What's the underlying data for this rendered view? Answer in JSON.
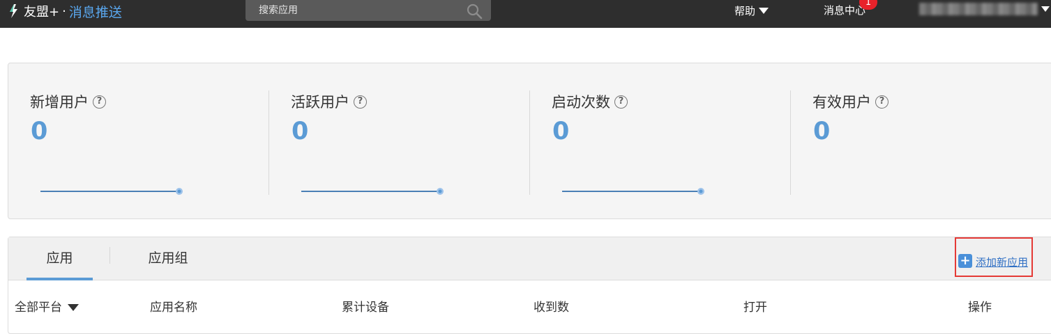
{
  "header": {
    "brand": "友盟+",
    "separator": "·",
    "product": "消息推送",
    "logo_icon": "umeng-logo-icon",
    "search": {
      "placeholder": "搜索应用",
      "icon": "search-icon"
    },
    "help": "帮助",
    "message_center": "消息中心",
    "message_badge": "1"
  },
  "stats": [
    {
      "label": "新增用户",
      "value": "0"
    },
    {
      "label": "活跃用户",
      "value": "0"
    },
    {
      "label": "启动次数",
      "value": "0"
    },
    {
      "label": "有效用户",
      "value": "0"
    }
  ],
  "apps": {
    "tabs": [
      {
        "label": "应用",
        "active": true
      },
      {
        "label": "应用组",
        "active": false
      }
    ],
    "add_app": "添加新应用",
    "columns": [
      "全部平台",
      "应用名称",
      "累计设备",
      "收到数",
      "打开",
      "操作"
    ]
  },
  "colors": {
    "accent": "#5b9bd5",
    "badge": "#e8222a",
    "highlight": "#e53935",
    "topbar": "#2e2e2e"
  }
}
